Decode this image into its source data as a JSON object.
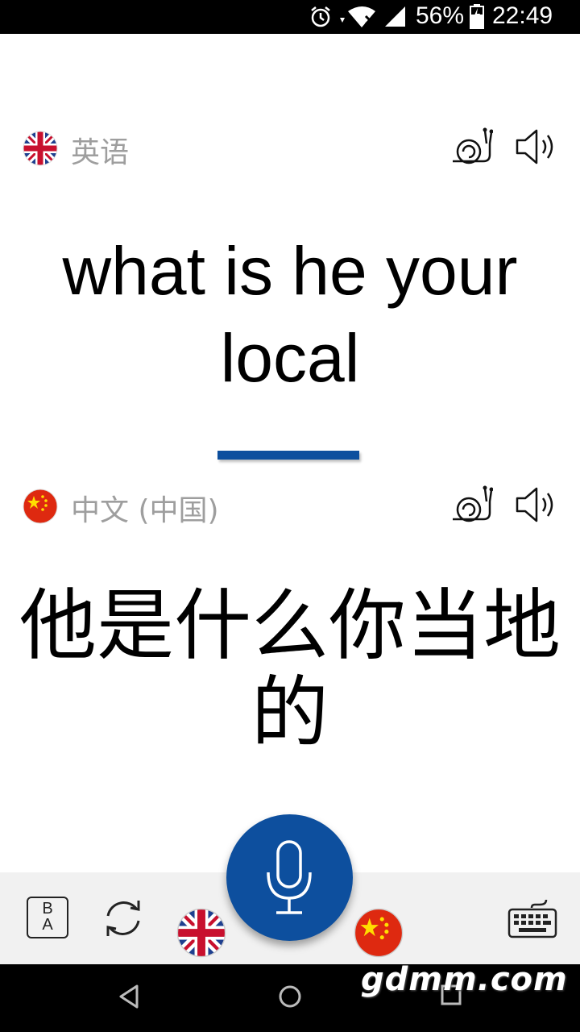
{
  "status_bar": {
    "battery_percent": "56%",
    "clock": "22:49",
    "icons": [
      "alarm-icon",
      "wifi-icon",
      "signal-icon",
      "battery-icon"
    ]
  },
  "source": {
    "language_label": "英语",
    "flag": "uk-flag-icon",
    "text": "what is he your local"
  },
  "target": {
    "language_label": "中文 (中国)",
    "flag": "china-flag-icon",
    "text": "他是什么你当地的"
  },
  "toolbar": {
    "ab_top": "B",
    "ab_bottom": "A",
    "icons": [
      "ab-toggle-icon",
      "swap-icon",
      "uk-flag-icon",
      "microphone-icon",
      "china-flag-icon",
      "keyboard-icon"
    ]
  },
  "watermark": "gdmm.com",
  "colors": {
    "accent": "#0d4f9e",
    "label_gray": "#9e9e9e",
    "toolbar_bg": "#f1f1f1"
  }
}
